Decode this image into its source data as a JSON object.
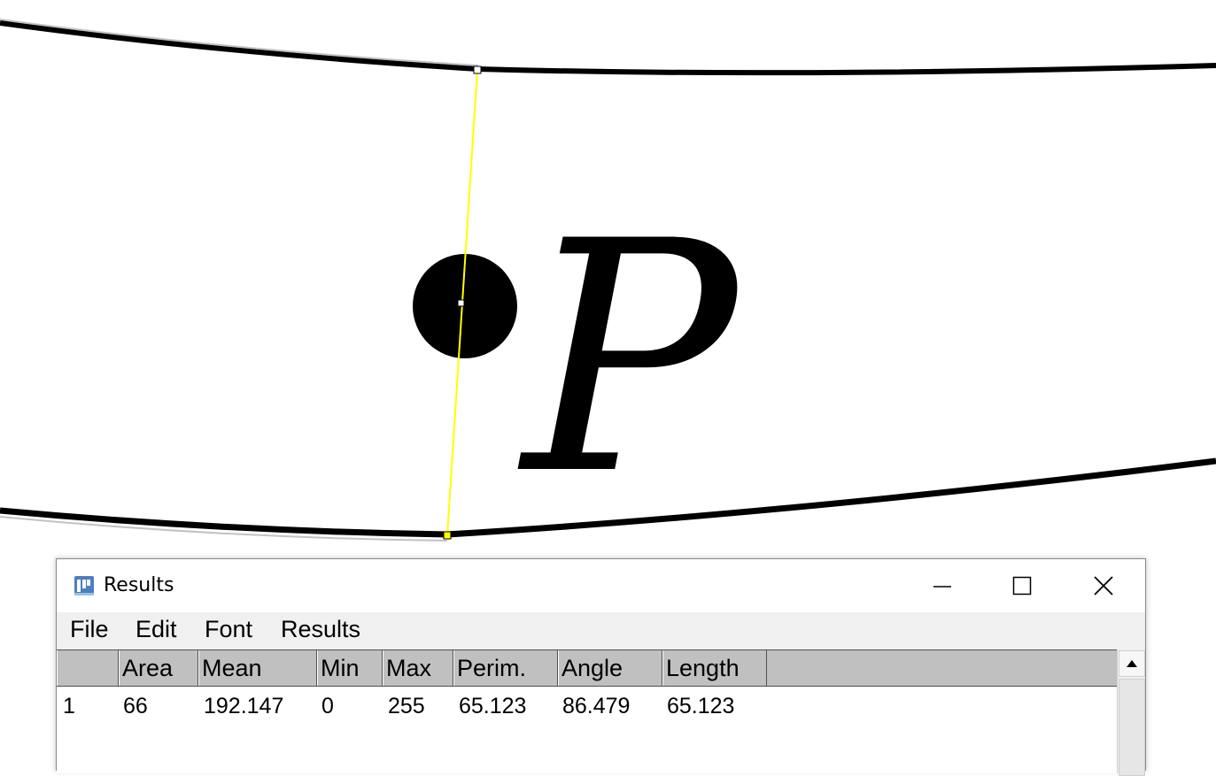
{
  "image_canvas": {
    "label_letter": "P",
    "colors": {
      "selection_line": "#ffff00",
      "ink": "#000000",
      "background": "#ffffff"
    }
  },
  "results_window": {
    "title": "Results",
    "icon": "imagej-icon",
    "controls": {
      "minimize_icon": "minimize-icon",
      "maximize_icon": "maximize-icon",
      "close_icon": "close-icon"
    },
    "menu": [
      "File",
      "Edit",
      "Font",
      "Results"
    ],
    "table": {
      "columns": [
        "",
        "Area",
        "Mean",
        "Min",
        "Max",
        "Perim.",
        "Angle",
        "Length"
      ],
      "rows": [
        [
          "1",
          "66",
          "192.147",
          "0",
          "255",
          "65.123",
          "86.479",
          "65.123"
        ]
      ]
    },
    "colors": {
      "header_bg": "#c0c0c0",
      "menubar_bg": "#f0f0f0",
      "icon_blue": "#4a7fc1"
    }
  }
}
